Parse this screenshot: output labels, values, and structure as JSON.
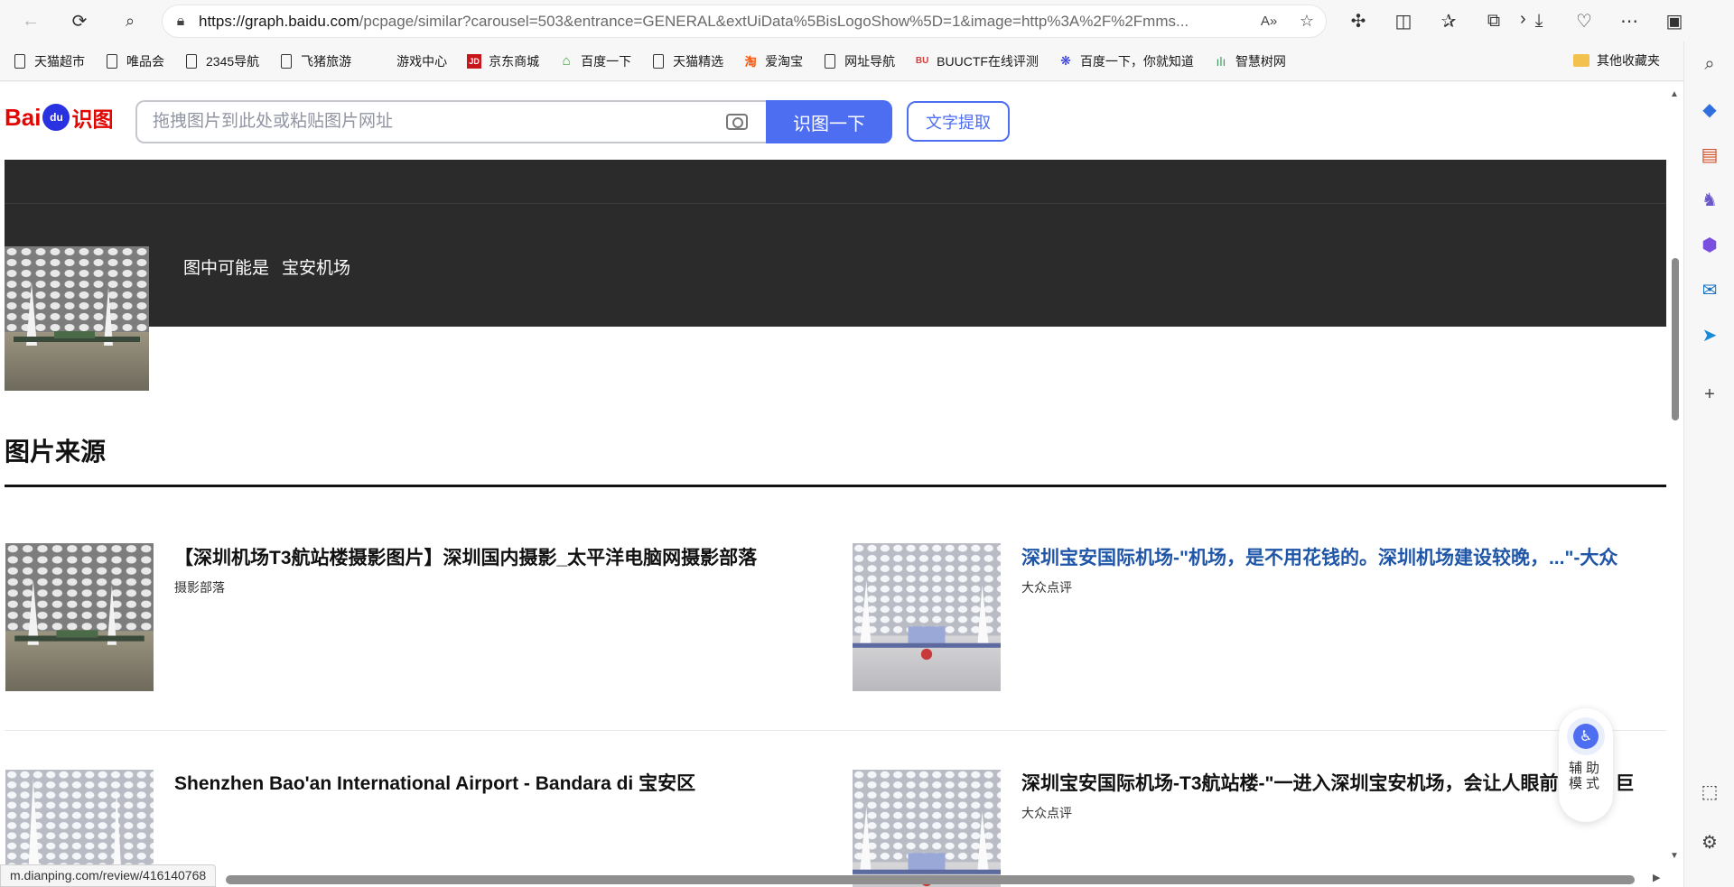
{
  "browser": {
    "url_host": "https://graph.baidu.com",
    "url_rest": "/pcpage/similar?carousel=503&entrance=GENERAL&extUiData%5BisLogoShow%5D=1&image=http%3A%2F%2Fmms..."
  },
  "bookmarks": [
    {
      "label": "天猫超市",
      "icon": "page-icon"
    },
    {
      "label": "唯品会",
      "icon": "page-icon"
    },
    {
      "label": "2345导航",
      "icon": "page-icon"
    },
    {
      "label": "飞猪旅游",
      "icon": "page-icon"
    },
    {
      "label": "游戏中心",
      "icon": "none"
    },
    {
      "label": "京东商城",
      "icon": "jd-icon"
    },
    {
      "label": "百度一下",
      "icon": "house-icon"
    },
    {
      "label": "天猫精选",
      "icon": "page-icon"
    },
    {
      "label": "爱淘宝",
      "icon": "taobao-icon"
    },
    {
      "label": "网址导航",
      "icon": "page-icon"
    },
    {
      "label": "BUUCTF在线评测",
      "icon": "buu-icon"
    },
    {
      "label": "百度一下，你就知道",
      "icon": "baidu-paw-icon"
    },
    {
      "label": "智慧树网",
      "icon": "zhihuishu-icon"
    }
  ],
  "bookmarks_folder": "其他收藏夹",
  "baidu": {
    "logo_text_1": "Bai",
    "logo_paw": "du",
    "logo_text_2": "识图",
    "search_placeholder": "拖拽图片到此处或粘贴图片网址",
    "search_button": "识图一下",
    "ocr_button": "文字提取"
  },
  "recognition": {
    "prefix": "图中可能是",
    "result": "宝安机场"
  },
  "sources_title": "图片来源",
  "results": [
    {
      "title": "【深圳机场T3航站楼摄影图片】深圳国内摄影_太平洋电脑网摄影部落",
      "source": "摄影部落",
      "highlighted": false
    },
    {
      "title": "深圳宝安国际机场-\"机场，是不用花钱的。深圳机场建设较晚，...\"-大众",
      "source": "大众点评",
      "highlighted": true
    },
    {
      "title": "Shenzhen Bao'an International Airport - Bandara di 宝安区",
      "source": "",
      "highlighted": false
    },
    {
      "title": "深圳宝安国际机场-T3航站楼-\"一进入深圳宝安机场，会让人眼前一亮，巨",
      "source": "大众点评",
      "highlighted": false
    }
  ],
  "assist_label": "辅助模式",
  "status_url": "m.dianping.com/review/416140768",
  "colors": {
    "baidu_blue": "#4e6ef2",
    "baidu_red": "#e10602",
    "dark_band": "#2b2b2b",
    "link_blue": "#2056a8"
  }
}
